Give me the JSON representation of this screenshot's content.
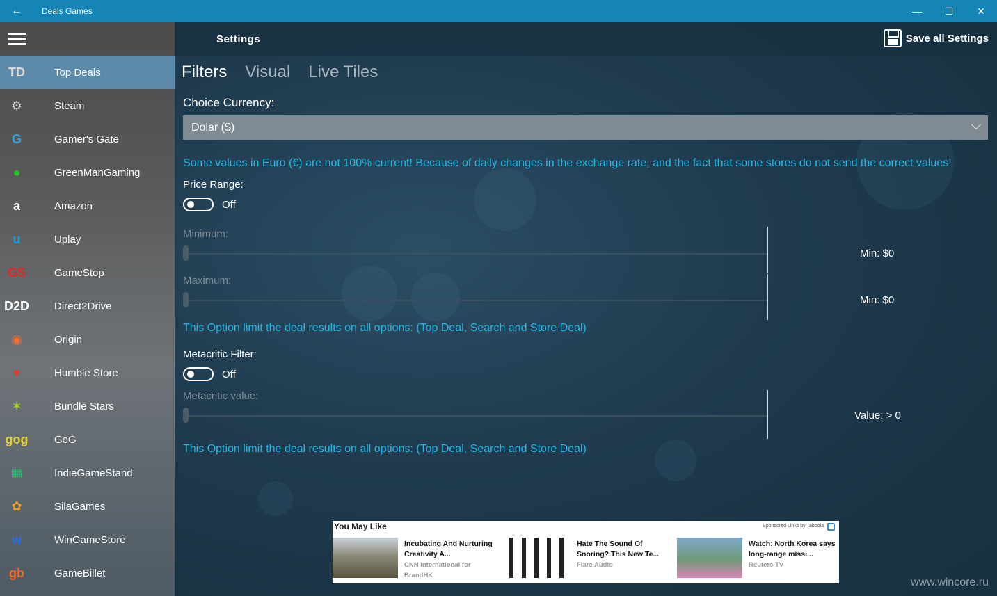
{
  "window": {
    "title": "Deals Games",
    "back_glyph": "←",
    "minimize_glyph": "—",
    "maximize_glyph": "☐",
    "close_glyph": "✕"
  },
  "sidebar": {
    "items": [
      {
        "label": "Top Deals",
        "icon": "top-deals-icon",
        "glyph": "TD",
        "color": "#d8d8d8"
      },
      {
        "label": "Steam",
        "icon": "steam-icon",
        "glyph": "⚙",
        "color": "#cfd3d6"
      },
      {
        "label": "Gamer's Gate",
        "icon": "gamers-gate-icon",
        "glyph": "G",
        "color": "#3aa0d8"
      },
      {
        "label": "GreenManGaming",
        "icon": "greenmangaming-icon",
        "glyph": "●",
        "color": "#25c41f"
      },
      {
        "label": "Amazon",
        "icon": "amazon-icon",
        "glyph": "a",
        "color": "#ffffff"
      },
      {
        "label": "Uplay",
        "icon": "uplay-icon",
        "glyph": "u",
        "color": "#1a9be0"
      },
      {
        "label": "GameStop",
        "icon": "gamestop-icon",
        "glyph": "GS",
        "color": "#e02727"
      },
      {
        "label": "Direct2Drive",
        "icon": "direct2drive-icon",
        "glyph": "D2D",
        "color": "#ffffff"
      },
      {
        "label": "Origin",
        "icon": "origin-icon",
        "glyph": "◉",
        "color": "#f56c2d"
      },
      {
        "label": "Humble Store",
        "icon": "humble-store-icon",
        "glyph": "♥",
        "color": "#e23a3a"
      },
      {
        "label": "Bundle Stars",
        "icon": "bundle-stars-icon",
        "glyph": "✶",
        "color": "#a8d82a"
      },
      {
        "label": "GoG",
        "icon": "gog-icon",
        "glyph": "gog",
        "color": "#e2d23a"
      },
      {
        "label": "IndieGameStand",
        "icon": "indiegamestand-icon",
        "glyph": "▦",
        "color": "#2cb36c"
      },
      {
        "label": "SilaGames",
        "icon": "silagames-icon",
        "glyph": "✿",
        "color": "#f0a020"
      },
      {
        "label": "WinGameStore",
        "icon": "wingamestore-icon",
        "glyph": "w",
        "color": "#2a6fd8"
      },
      {
        "label": "GameBillet",
        "icon": "gamebillet-icon",
        "glyph": "gb",
        "color": "#f2682a"
      }
    ]
  },
  "header": {
    "title": "Settings",
    "save_label": "Save all Settings"
  },
  "tabs": [
    {
      "label": "Filters"
    },
    {
      "label": "Visual"
    },
    {
      "label": "Live Tiles"
    }
  ],
  "filters": {
    "currency_label": "Choice Currency:",
    "currency_value": "Dolar ($)",
    "euro_warning": "Some values in Euro (€) are not 100% current! Because of daily changes in the exchange rate, and the fact that some stores do not send the correct values!",
    "price_range_label": "Price Range:",
    "price_range_state": "Off",
    "minimum_label": "Minimum:",
    "minimum_value": "Min: $0",
    "maximum_label": "Maximum:",
    "maximum_value": "Min: $0",
    "price_note": "This Option limit the deal results on all options: (Top Deal, Search and Store Deal)",
    "metacritic_label": "Metacritic Filter:",
    "metacritic_state": "Off",
    "metacritic_value_label": "Metacritic value:",
    "metacritic_value": "Value: > 0",
    "metacritic_note": "This Option limit the deal results on all options: (Top Deal, Search and Store Deal)"
  },
  "ad": {
    "title": "You May Like",
    "sponsor": "Sponsored Links by Taboola",
    "cards": [
      {
        "headline": "Incubating And Nurturing Creativity A...",
        "source": "CNN International for BrandHK"
      },
      {
        "headline": "Hate The Sound Of Snoring? This New Te...",
        "source": "Flare Audio"
      },
      {
        "headline": "Watch: North Korea says long-range missi...",
        "source": "Reuters TV"
      }
    ]
  },
  "watermark": "www.wincore.ru"
}
